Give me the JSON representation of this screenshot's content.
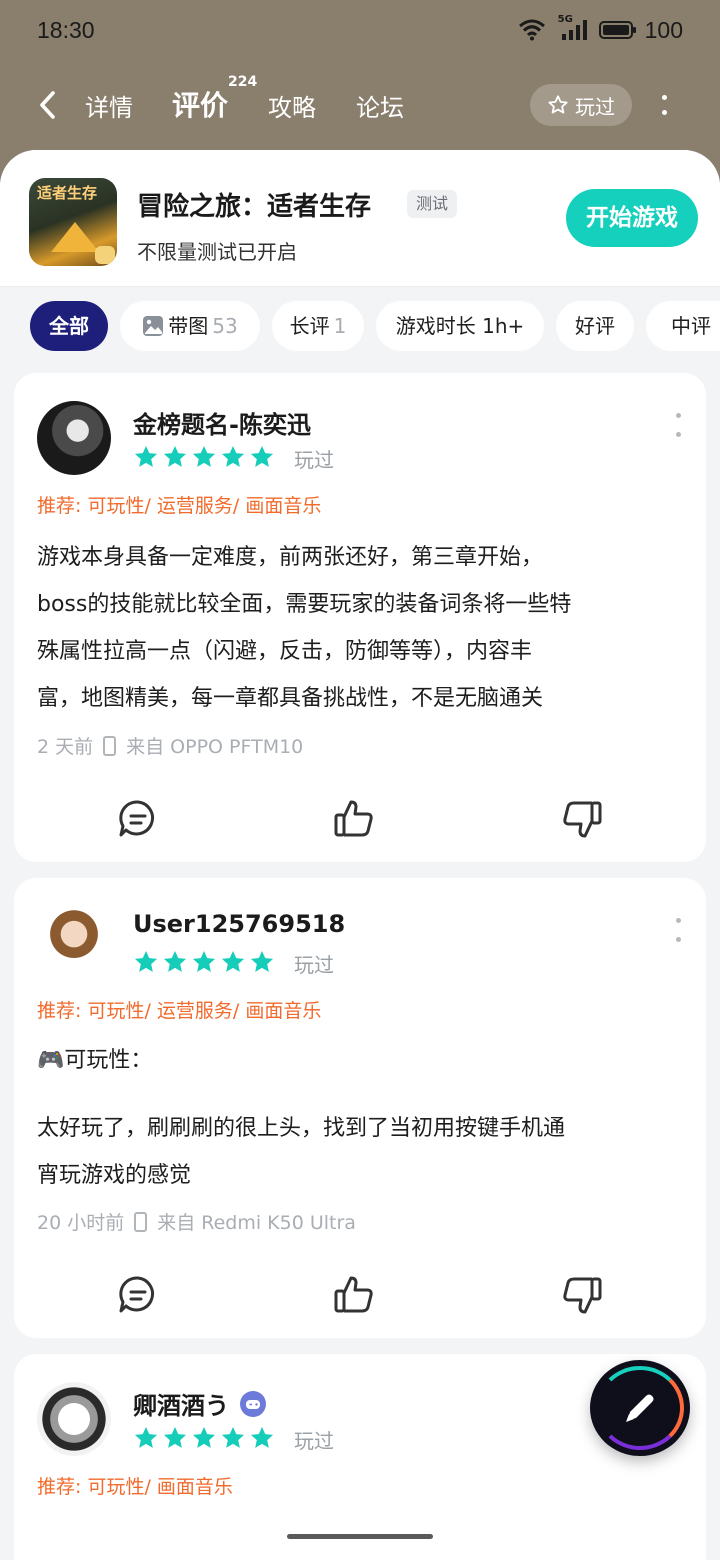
{
  "status_bar": {
    "time": "18:30",
    "network": "5G",
    "battery": "100"
  },
  "nav": {
    "tabs": [
      {
        "label": "详情"
      },
      {
        "label": "评价",
        "badge": "224"
      },
      {
        "label": "攻略"
      },
      {
        "label": "论坛"
      }
    ],
    "played_label": "玩过"
  },
  "game": {
    "icon_text": "适者生存",
    "name": "冒险之旅：适者生存",
    "tag": "测试",
    "subtitle": "不限量测试已开启",
    "start_label": "开始游戏"
  },
  "filters": [
    {
      "label": "全部",
      "count": ""
    },
    {
      "label": "带图",
      "count": "53"
    },
    {
      "label": "长评",
      "count": "1"
    },
    {
      "label": "游戏时长 1h+",
      "count": ""
    },
    {
      "label": "好评",
      "count": ""
    },
    {
      "label": "中评",
      "count": ""
    }
  ],
  "reviews": [
    {
      "user": "金榜题名-陈奕迅",
      "rating": 5,
      "status": "玩过",
      "recommend": "推荐: 可玩性/ 运营服务/ 画面音乐",
      "lines": [
        "游戏本身具备一定难度，前两张还好，第三章开始，",
        "boss的技能就比较全面，需要玩家的装备词条将一些特",
        "殊属性拉高一点（闪避，反击，防御等等），内容丰",
        "富，地图精美，每一章都具备挑战性，不是无脑通关"
      ],
      "time": "2 天前",
      "device": "来自 OPPO PFTM10"
    },
    {
      "user": "User125769518",
      "rating": 5,
      "status": "玩过",
      "recommend": "推荐: 可玩性/ 运营服务/ 画面音乐",
      "heading": "🎮可玩性：",
      "lines": [
        "太好玩了，刷刷刷的很上头，找到了当初用按键手机通",
        "宵玩游戏的感觉"
      ],
      "time": "20 小时前",
      "device": "来自 Redmi K50 Ultra"
    },
    {
      "user": "卿酒酒う",
      "rating": 5,
      "status": "玩过",
      "recommend": "推荐: 可玩性/ 画面音乐"
    }
  ],
  "colors": {
    "accent": "#15d0bd",
    "header": "#8a7e6c",
    "recommend": "#f26b2c",
    "chip_active": "#1d1f7a",
    "star": "#15cdb9"
  },
  "icons": [
    "back-arrow-icon",
    "star-outline-icon",
    "comment-icon",
    "thumb-up-icon",
    "thumb-down-icon",
    "edit-pen-icon",
    "phone-icon",
    "image-icon",
    "gamepad-badge-icon"
  ]
}
